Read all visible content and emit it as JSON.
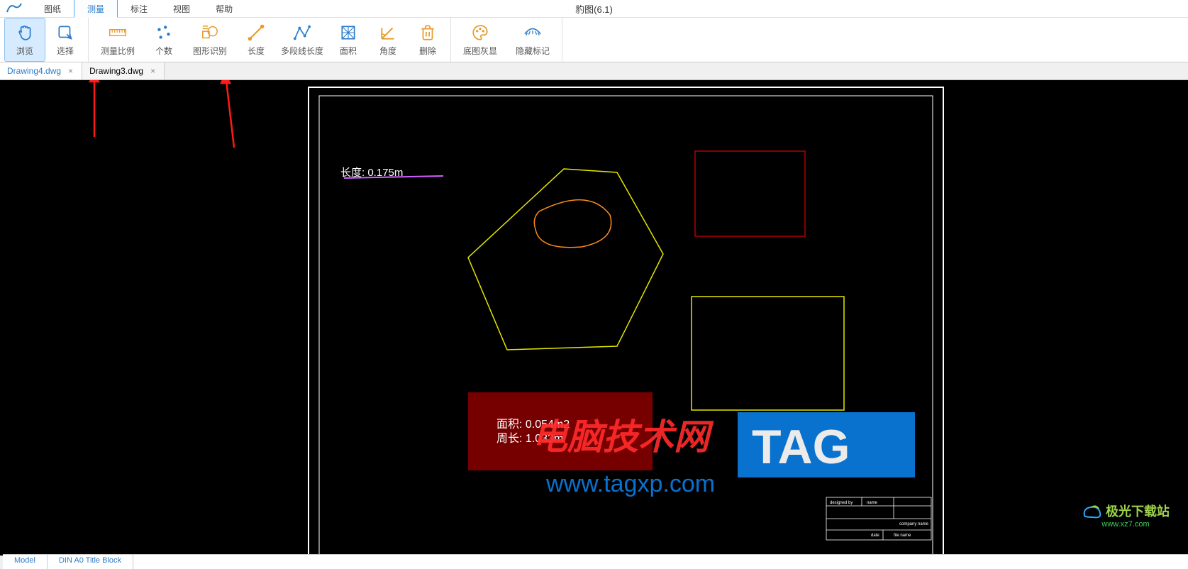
{
  "app": {
    "title": "豹图(6.1)"
  },
  "menu": {
    "items": [
      {
        "label": "图纸"
      },
      {
        "label": "测量",
        "active": true
      },
      {
        "label": "标注"
      },
      {
        "label": "视图"
      },
      {
        "label": "帮助"
      }
    ]
  },
  "toolbar": {
    "groups": [
      {
        "name": "nav",
        "buttons": [
          {
            "id": "browse",
            "label": "浏览",
            "icon": "hand-icon",
            "active": true
          },
          {
            "id": "select",
            "label": "选择",
            "icon": "select-icon"
          }
        ]
      },
      {
        "name": "measure",
        "buttons": [
          {
            "id": "scale",
            "label": "测量比例",
            "icon": "ruler-icon",
            "wide": true
          },
          {
            "id": "count",
            "label": "个数",
            "icon": "dots-icon"
          },
          {
            "id": "shape-recog",
            "label": "图形识别",
            "icon": "shapes-icon",
            "wide": true
          },
          {
            "id": "length",
            "label": "长度",
            "icon": "line-icon"
          },
          {
            "id": "polyline-length",
            "label": "多段线长度",
            "icon": "polyline-icon",
            "wide": true
          },
          {
            "id": "area",
            "label": "面积",
            "icon": "area-icon"
          },
          {
            "id": "angle",
            "label": "角度",
            "icon": "angle-icon"
          },
          {
            "id": "delete",
            "label": "删除",
            "icon": "trash-icon"
          }
        ]
      },
      {
        "name": "view",
        "buttons": [
          {
            "id": "gray-base",
            "label": "底图灰显",
            "icon": "palette-icon",
            "wide": true
          },
          {
            "id": "hide-marks",
            "label": "隐藏标记",
            "icon": "eye-off-icon",
            "wide": true
          }
        ]
      }
    ]
  },
  "file_tabs": [
    {
      "label": "Drawing4.dwg",
      "active": true
    },
    {
      "label": "Drawing3.dwg"
    }
  ],
  "bottom_tabs": [
    {
      "label": "Model"
    },
    {
      "label": "DIN A0 Title Block"
    }
  ],
  "canvas": {
    "length_label": "长度: 0.175m",
    "area_label": "面积: 0.054m2",
    "perimeter_label": "周长: 1.033m"
  },
  "title_block": {
    "designed_by": "designed by",
    "name": "name",
    "company_name": "company name",
    "date": "date",
    "file_name": "file name"
  },
  "overlay": {
    "brand_cn": "电脑技术网",
    "tag": "TAG",
    "url": "www.tagxp.com"
  },
  "watermark": {
    "title": "极光下载站",
    "url": "www.xz7.com"
  },
  "annotation_arrows": [
    {
      "note": "points to 测量 menu"
    },
    {
      "note": "points to 长度 toolbar button"
    }
  ]
}
